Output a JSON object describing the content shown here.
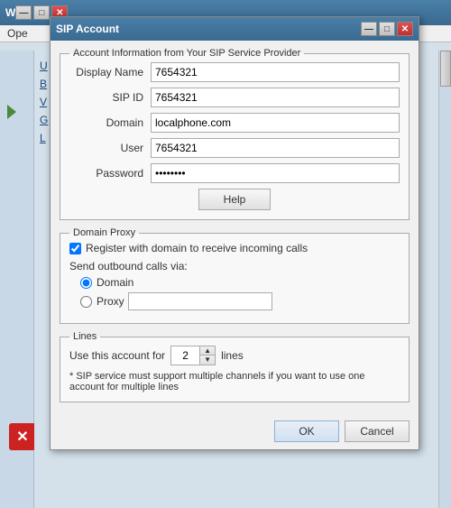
{
  "bg_window": {
    "title": "W",
    "menu": "Ope",
    "list_items": [
      "U",
      "B",
      "V",
      "G",
      "L"
    ]
  },
  "dialog": {
    "title": "SIP Account",
    "sections": {
      "account_info": {
        "legend": "Account Information from Your SIP Service Provider",
        "fields": {
          "display_name": {
            "label": "Display Name",
            "value": "7654321"
          },
          "sip_id": {
            "label": "SIP ID",
            "value": "7654321"
          },
          "domain": {
            "label": "Domain",
            "value": "localphone.com"
          },
          "user": {
            "label": "User",
            "value": "7654321"
          },
          "password": {
            "label": "Password",
            "value": "••••••••"
          }
        },
        "help_button": "Help"
      },
      "domain_proxy": {
        "legend": "Domain Proxy",
        "register_label": "Register with domain to receive incoming calls",
        "register_checked": true,
        "send_label": "Send outbound calls via:",
        "options": [
          {
            "label": "Domain",
            "selected": true
          },
          {
            "label": "Proxy",
            "selected": false
          }
        ]
      },
      "lines": {
        "legend": "Lines",
        "prefix": "Use this account for",
        "value": "2",
        "suffix": "lines",
        "note": "* SIP service must support multiple channels if you want to use one account for multiple lines"
      }
    },
    "footer": {
      "ok_label": "OK",
      "cancel_label": "Cancel"
    },
    "title_buttons": {
      "minimize": "—",
      "maximize": "□",
      "close": "✕"
    }
  }
}
